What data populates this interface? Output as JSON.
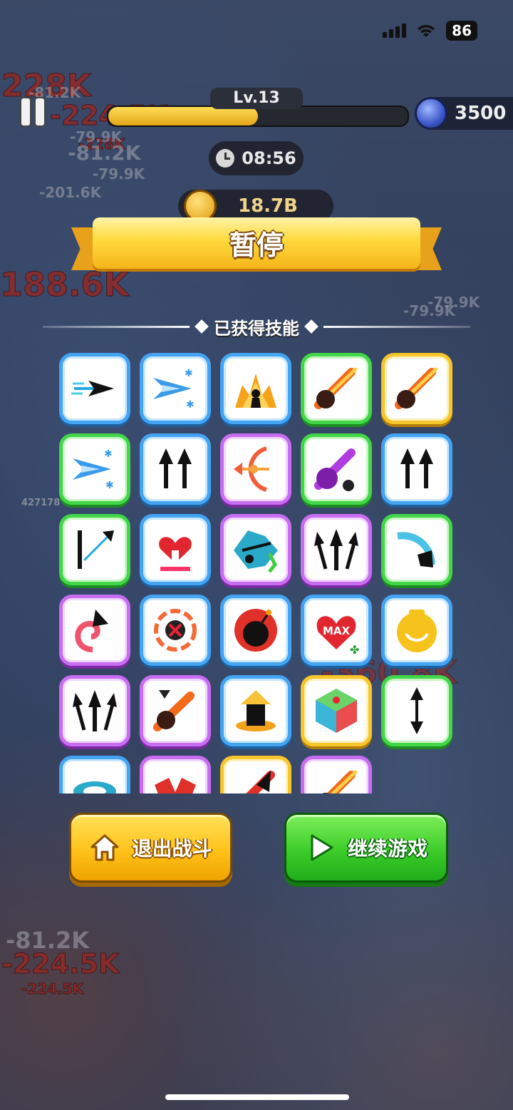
{
  "status_bar": {
    "battery": "86"
  },
  "hud": {
    "level": "Lv.13",
    "xp_progress": 0.5,
    "gems": "3500",
    "timer": "08:56",
    "gold": "18.7B"
  },
  "background_damage": [
    "228K",
    "-81.2K",
    "-224.5K",
    "-228K",
    "-79.9K",
    "-81.2K",
    "-79.9K",
    "-201.6K",
    "188.6K",
    "-79.9K",
    "-79.9K",
    "-81.2K",
    "-224.5K",
    "-224.5K",
    "427178",
    "-360.8K"
  ],
  "pause_menu": {
    "title": "暂停",
    "section_title": "已获得技能",
    "skills": [
      {
        "icon": "dash-arrow-icon",
        "rarity": "blue"
      },
      {
        "icon": "ice-arrow-icon",
        "rarity": "blue"
      },
      {
        "icon": "heart-burst-icon",
        "rarity": "blue"
      },
      {
        "icon": "skull-meteor-icon",
        "rarity": "green"
      },
      {
        "icon": "fire-meteor-icon",
        "rarity": "yellow"
      },
      {
        "icon": "frost-bomb-icon",
        "rarity": "green"
      },
      {
        "icon": "double-arrow-icon",
        "rarity": "blue"
      },
      {
        "icon": "winged-bow-icon",
        "rarity": "purple"
      },
      {
        "icon": "poison-meteor-icon",
        "rarity": "green"
      },
      {
        "icon": "double-arrow-icon",
        "rarity": "blue"
      },
      {
        "icon": "ricochet-arrow-icon",
        "rarity": "green"
      },
      {
        "icon": "broken-heart-icon",
        "rarity": "blue"
      },
      {
        "icon": "archer-boost-icon",
        "rarity": "purple"
      },
      {
        "icon": "triple-arrow-icon",
        "rarity": "purple"
      },
      {
        "icon": "dark-swing-icon",
        "rarity": "green"
      },
      {
        "icon": "spiral-arrow-icon",
        "rarity": "purple"
      },
      {
        "icon": "target-cross-icon",
        "rarity": "blue"
      },
      {
        "icon": "bomb-icon",
        "rarity": "blue"
      },
      {
        "icon": "max-heart-icon",
        "rarity": "blue",
        "label": "MAX"
      },
      {
        "icon": "gold-potion-icon",
        "rarity": "blue"
      },
      {
        "icon": "triple-arrow-icon",
        "rarity": "purple"
      },
      {
        "icon": "demon-meteor-icon",
        "rarity": "purple"
      },
      {
        "icon": "fire-pillar-icon",
        "rarity": "blue"
      },
      {
        "icon": "element-dice-icon",
        "rarity": "yellow"
      },
      {
        "icon": "two-way-arrow-icon",
        "rarity": "green"
      },
      {
        "icon": "vortex-icon",
        "rarity": "blue"
      },
      {
        "icon": "demon-wings-icon",
        "rarity": "purple"
      },
      {
        "icon": "shadow-blade-icon",
        "rarity": "yellow"
      },
      {
        "icon": "flame-meteor-icon",
        "rarity": "purple"
      }
    ],
    "exit_label": "退出战斗",
    "continue_label": "继续游戏"
  }
}
